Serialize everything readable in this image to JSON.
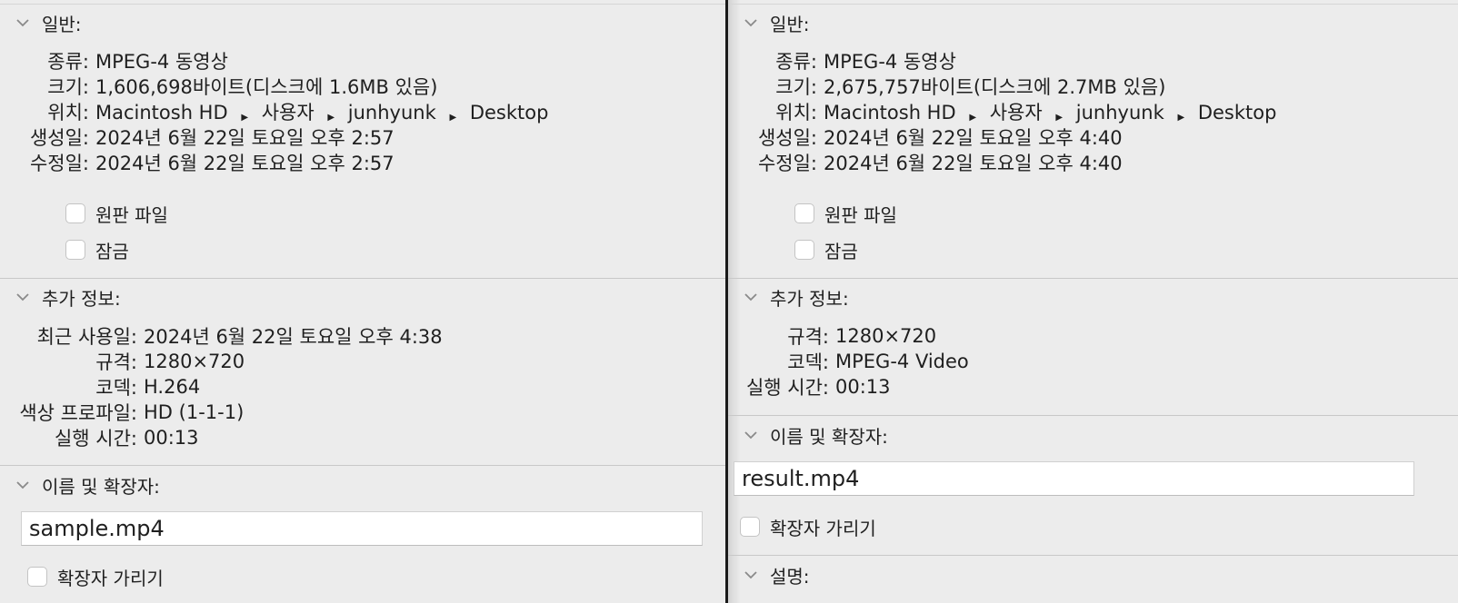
{
  "left": {
    "general": {
      "title": "일반:",
      "kind_label": "종류:",
      "kind_value": "MPEG-4 동영상",
      "size_label": "크기:",
      "size_value": "1,606,698바이트(디스크에 1.6MB 있음)",
      "where_label": "위치:",
      "where_path": [
        "Macintosh HD",
        "사용자",
        "junhyunk",
        "Desktop"
      ],
      "created_label": "생성일:",
      "created_value": "2024년 6월 22일 토요일 오후 2:57",
      "modified_label": "수정일:",
      "modified_value": "2024년 6월 22일 토요일 오후 2:57",
      "stationery_label": "원판 파일",
      "stationery_checked": false,
      "locked_label": "잠금",
      "locked_checked": false
    },
    "more_info": {
      "title": "추가 정보:",
      "last_opened_label": "최근 사용일:",
      "last_opened_value": "2024년 6월 22일 토요일 오후 4:38",
      "dimensions_label": "규격:",
      "dimensions_value": "1280×720",
      "codecs_label": "코덱:",
      "codecs_value": "H.264",
      "color_profile_label": "색상 프로파일:",
      "color_profile_value": "HD (1-1-1)",
      "duration_label": "실행 시간:",
      "duration_value": "00:13"
    },
    "name_ext": {
      "title": "이름 및 확장자:",
      "filename": "sample.mp4",
      "hide_ext_label": "확장자 가리기",
      "hide_ext_checked": false
    }
  },
  "right": {
    "general": {
      "title": "일반:",
      "kind_label": "종류:",
      "kind_value": "MPEG-4 동영상",
      "size_label": "크기:",
      "size_value": "2,675,757바이트(디스크에 2.7MB 있음)",
      "where_label": "위치:",
      "where_path": [
        "Macintosh HD",
        "사용자",
        "junhyunk",
        "Desktop"
      ],
      "created_label": "생성일:",
      "created_value": "2024년 6월 22일 토요일 오후 4:40",
      "modified_label": "수정일:",
      "modified_value": "2024년 6월 22일 토요일 오후 4:40",
      "stationery_label": "원판 파일",
      "stationery_checked": false,
      "locked_label": "잠금",
      "locked_checked": false
    },
    "more_info": {
      "title": "추가 정보:",
      "dimensions_label": "규격:",
      "dimensions_value": "1280×720",
      "codecs_label": "코덱:",
      "codecs_value": "MPEG-4 Video",
      "duration_label": "실행 시간:",
      "duration_value": "00:13"
    },
    "name_ext": {
      "title": "이름 및 확장자:",
      "filename": "result.mp4",
      "hide_ext_label": "확장자 가리기",
      "hide_ext_checked": false
    },
    "comments": {
      "title": "설명:"
    }
  },
  "icons": {
    "disclosure": "chevron-down-icon",
    "path_separator": "triangle-right-icon"
  }
}
